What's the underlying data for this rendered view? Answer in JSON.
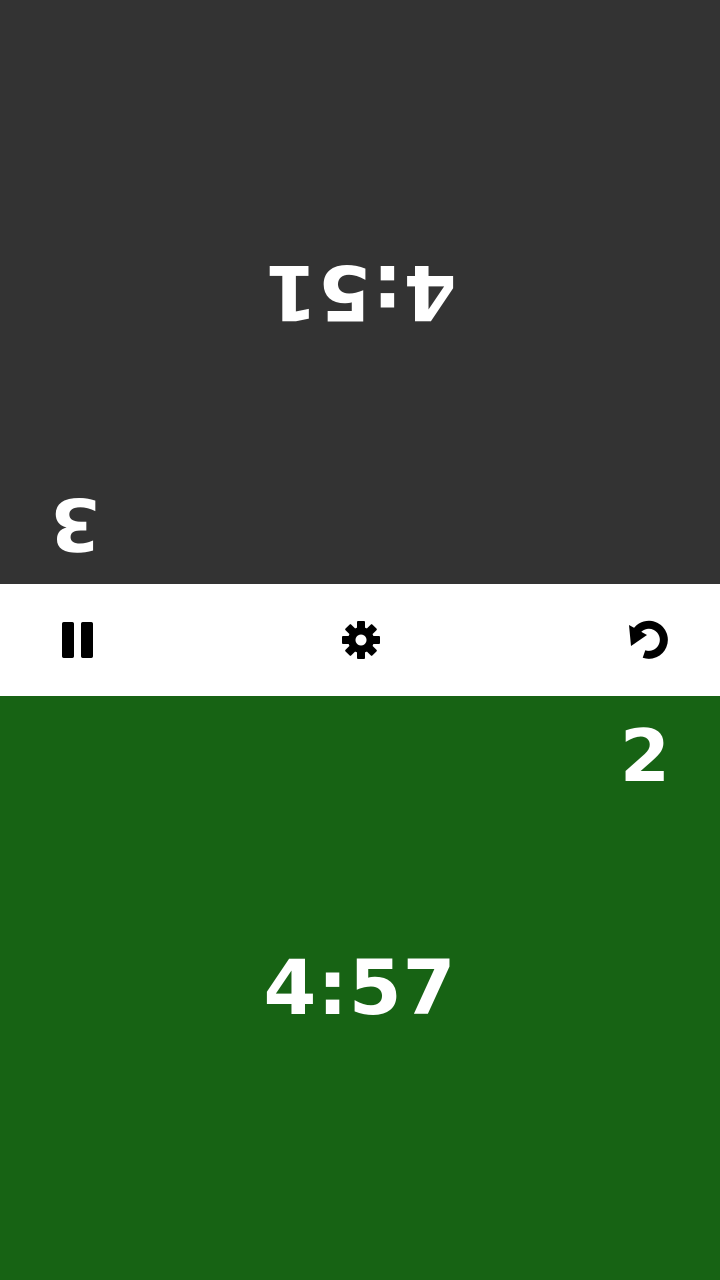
{
  "colors": {
    "top_panel_bg": "#333333",
    "bottom_panel_bg": "#176314",
    "toolbar_bg": "#ffffff",
    "text": "#ffffff",
    "icon": "#000000"
  },
  "top_player": {
    "time": "4:51",
    "moves": "3",
    "orientation": "rotated-180"
  },
  "bottom_player": {
    "time": "4:57",
    "moves": "2",
    "active": true
  },
  "toolbar": {
    "pause_icon": "pause-icon",
    "settings_icon": "gear-icon",
    "reset_icon": "reset-icon"
  }
}
